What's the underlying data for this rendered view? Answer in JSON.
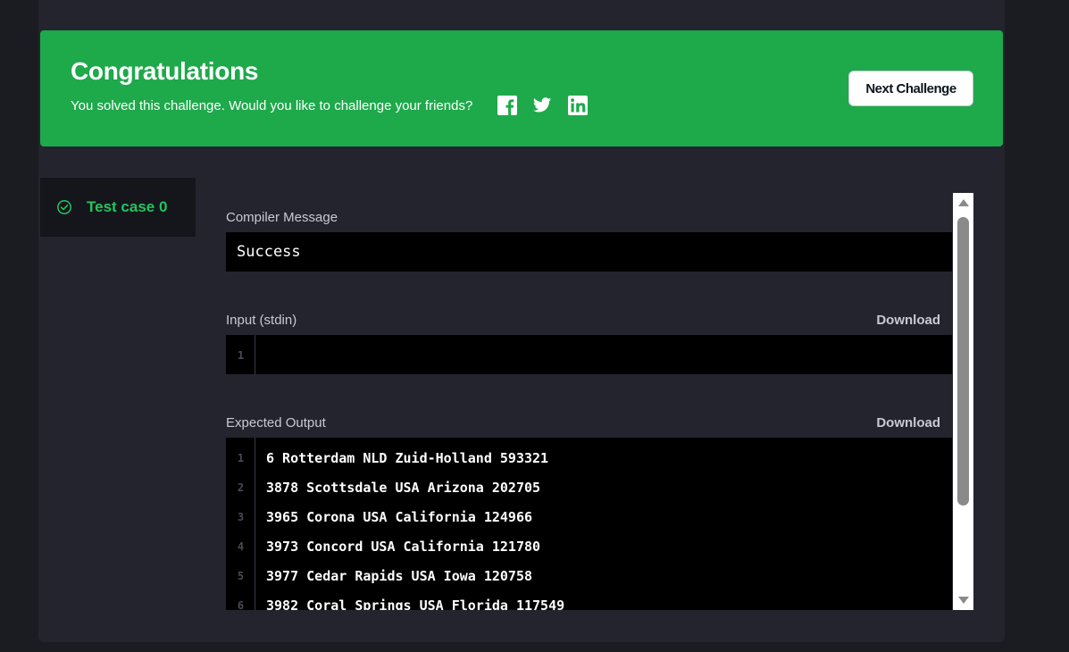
{
  "banner": {
    "title": "Congratulations",
    "message": "You solved this challenge. Would you like to challenge your friends?",
    "next_button": "Next Challenge",
    "social_icons": [
      "facebook-icon",
      "twitter-icon",
      "linkedin-icon"
    ],
    "color": "#1ea94b"
  },
  "testcases": [
    {
      "label": "Test case 0",
      "status": "passed"
    }
  ],
  "compiler": {
    "label": "Compiler Message",
    "message": "Success"
  },
  "input": {
    "label": "Input (stdin)",
    "download": "Download",
    "lines": [
      ""
    ]
  },
  "expected": {
    "label": "Expected Output",
    "download": "Download",
    "lines": [
      "6 Rotterdam NLD Zuid-Holland 593321",
      "3878 Scottsdale USA Arizona 202705",
      "3965 Corona USA California 124966",
      "3973 Concord USA California 121780",
      "3977 Cedar Rapids USA Iowa 120758",
      "3982 Coral Springs USA Florida 117549"
    ]
  },
  "colors": {
    "success_green": "#22c55e",
    "panel_bg": "#23242e",
    "page_bg": "#1b1c21"
  }
}
